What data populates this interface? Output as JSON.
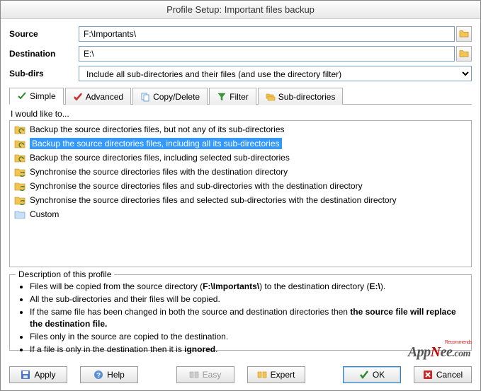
{
  "title": "Profile Setup: Important files backup",
  "fields": {
    "source_label": "Source",
    "source_value": "F:\\Importants\\",
    "destination_label": "Destination",
    "destination_value": "E:\\",
    "subdirs_label": "Sub-dirs",
    "subdirs_value": "Include all sub-directories and their files (and use the directory filter)"
  },
  "tabs": [
    {
      "label": "Simple"
    },
    {
      "label": "Advanced"
    },
    {
      "label": "Copy/Delete"
    },
    {
      "label": "Filter"
    },
    {
      "label": "Sub-directories"
    }
  ],
  "list_header": "I would like to...",
  "options": [
    {
      "text": "Backup the source directories files, but not any of its sub-directories",
      "selected": false
    },
    {
      "text": "Backup the source directories files, including all its sub-directories",
      "selected": true
    },
    {
      "text": "Backup the source directories files, including selected sub-directories",
      "selected": false
    },
    {
      "text": "Synchronise the source directories files with the destination directory",
      "selected": false
    },
    {
      "text": "Synchronise the source directories files and sub-directories with the destination directory",
      "selected": false
    },
    {
      "text": "Synchronise the source directories files and selected sub-directories with the destination directory",
      "selected": false
    },
    {
      "text": "Custom",
      "selected": false
    }
  ],
  "description_legend": "Description of this profile",
  "description_items": [
    {
      "html": "Files will be copied from the source directory (<b>F:\\Importants\\</b>) to the destination directory (<b>E:\\</b>)."
    },
    {
      "html": "All the sub-directories and their files will be copied."
    },
    {
      "html": "If the same file has been changed in both the source and destination directories then <b>the source file will replace the destination file.</b>"
    },
    {
      "html": "Files only in the source are copied to the destination."
    },
    {
      "html": "If a file is only in the destination then it is <b>ignored</b>."
    }
  ],
  "buttons": {
    "apply": "Apply",
    "help": "Help",
    "easy": "Easy",
    "expert": "Expert",
    "ok": "OK",
    "cancel": "Cancel"
  },
  "watermark": "AppNee.com",
  "watermark_sub": "Recommends"
}
